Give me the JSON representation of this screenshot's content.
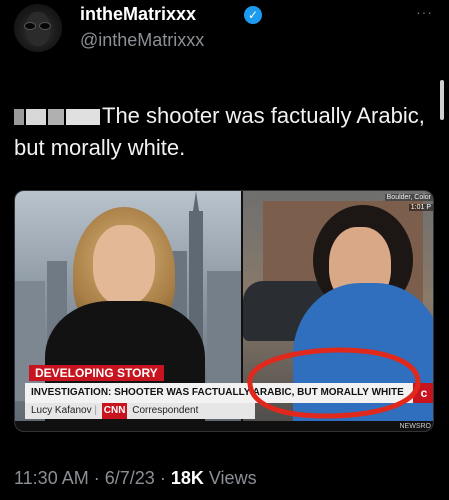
{
  "header": {
    "display_name": "intheMatrixxx",
    "handle": "@intheMatrixxx",
    "more_icon": "more-horizontal-icon"
  },
  "tweet": {
    "text": "The shooter was factually Arabic, but morally white."
  },
  "media": {
    "location": "Boulder, Color",
    "time": "1:01 P",
    "chyron": {
      "tag": "DEVELOPING STORY",
      "headline": "INVESTIGATION: SHOOTER WAS FACTUALLY ARABIC, BUT MORALLY WHITE",
      "byline_name": "Lucy Kafanov",
      "byline_network": "CNN",
      "byline_role": "Correspondent",
      "newsroom": "NEWSRO"
    },
    "annotation_color": "#e0281c"
  },
  "footer": {
    "time": "11:30 AM",
    "date": "6/7/23",
    "views_count": "18K",
    "views_label": "Views"
  },
  "colors": {
    "background": "#000000",
    "verified": "#1d9bf0",
    "cnn_red": "#c8141e"
  }
}
